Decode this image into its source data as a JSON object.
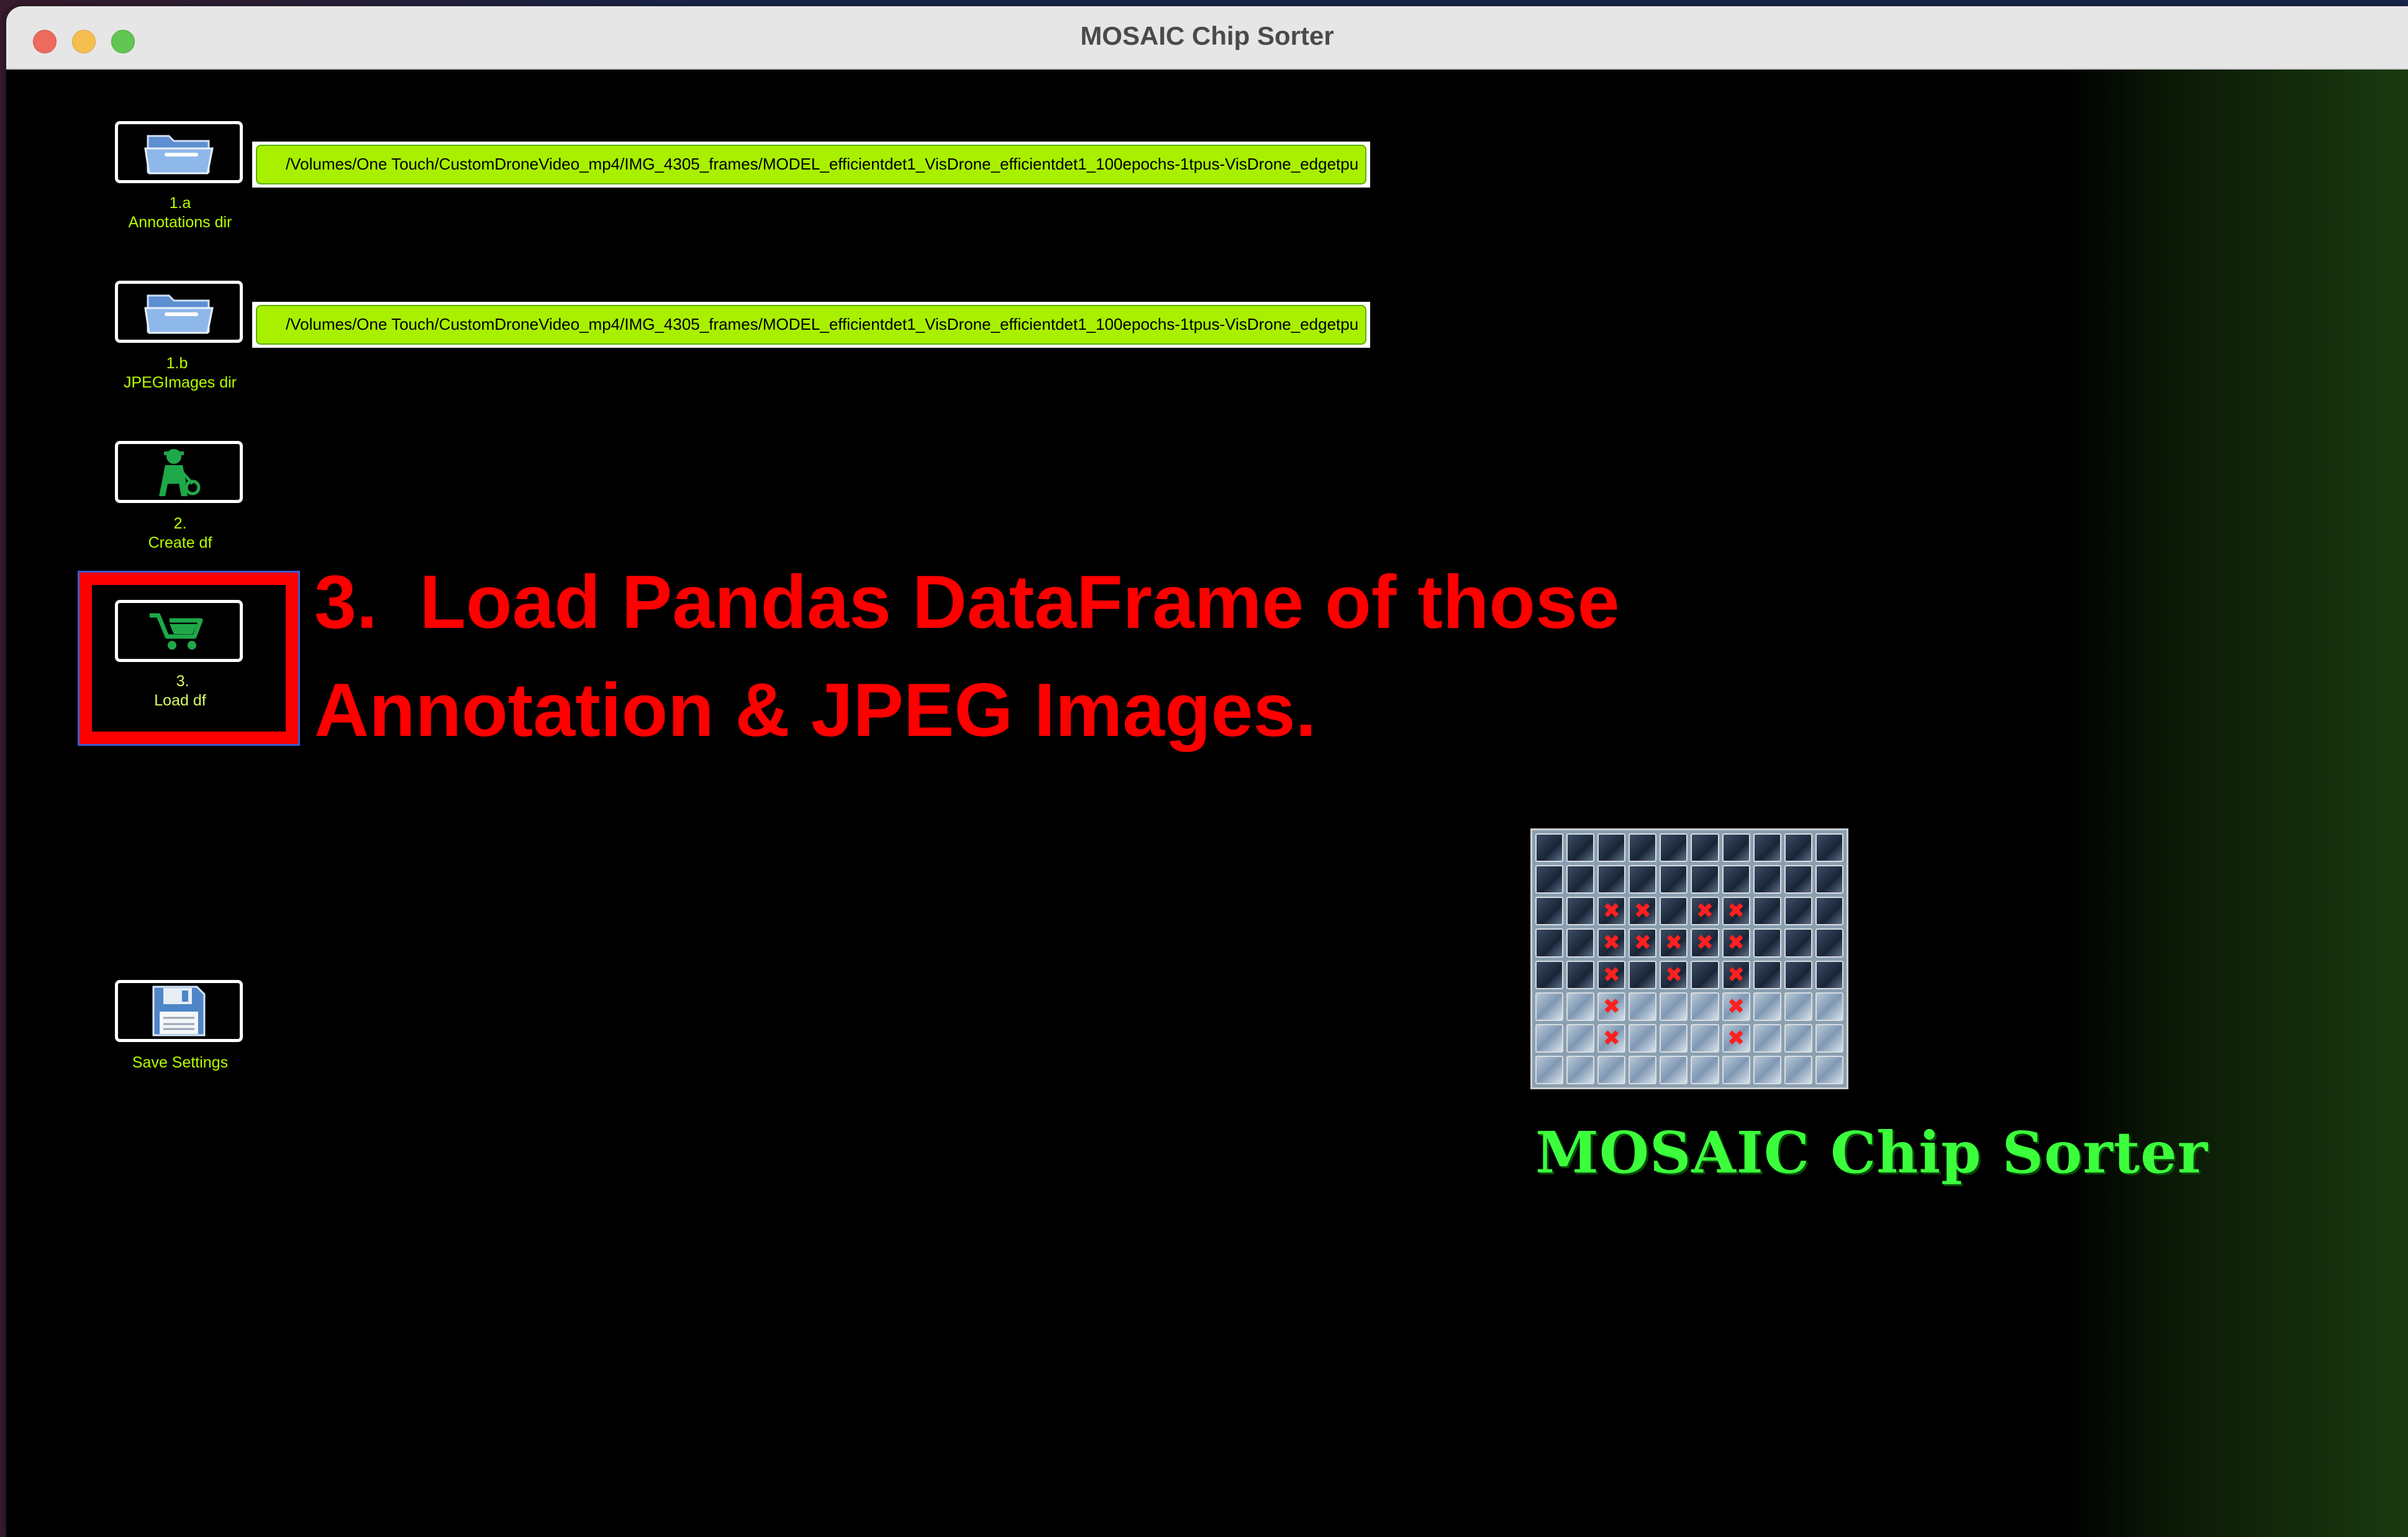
{
  "window": {
    "title": "MOSAIC Chip Sorter"
  },
  "controls": {
    "annotations_dir": {
      "step": "1.a",
      "label": "Annotations dir",
      "path": "/Volumes/One Touch/CustomDroneVideo_mp4/IMG_4305_frames/MODEL_efficientdet1_VisDrone_efficientdet1_100epochs-1tpus-VisDrone_edgetpu",
      "icon": "folder-icon"
    },
    "jpeg_dir": {
      "step": "1.b",
      "label": "JPEGImages dir",
      "path": "/Volumes/One Touch/CustomDroneVideo_mp4/IMG_4305_frames/MODEL_efficientdet1_VisDrone_efficientdet1_100epochs-1tpus-VisDrone_edgetpu",
      "icon": "folder-icon"
    },
    "create_df": {
      "step": "2.",
      "label": "Create df",
      "icon": "worker-icon"
    },
    "load_df": {
      "step": "3.",
      "label": "Load df",
      "icon": "cart-icon"
    },
    "save_settings": {
      "label": "Save Settings",
      "icon": "floppy-disk-icon"
    }
  },
  "annotation": {
    "line1": "3.  Load Pandas DataFrame of those",
    "line2": "Annotation & JPEG Images.",
    "color": "#ff0000"
  },
  "logo": {
    "text": "MOSAIC Chip Sorter",
    "text_color": "#3cff3c",
    "mark_color": "#ff2020"
  },
  "colors": {
    "label": "#b6ff00",
    "path_field": "#a8f000"
  }
}
